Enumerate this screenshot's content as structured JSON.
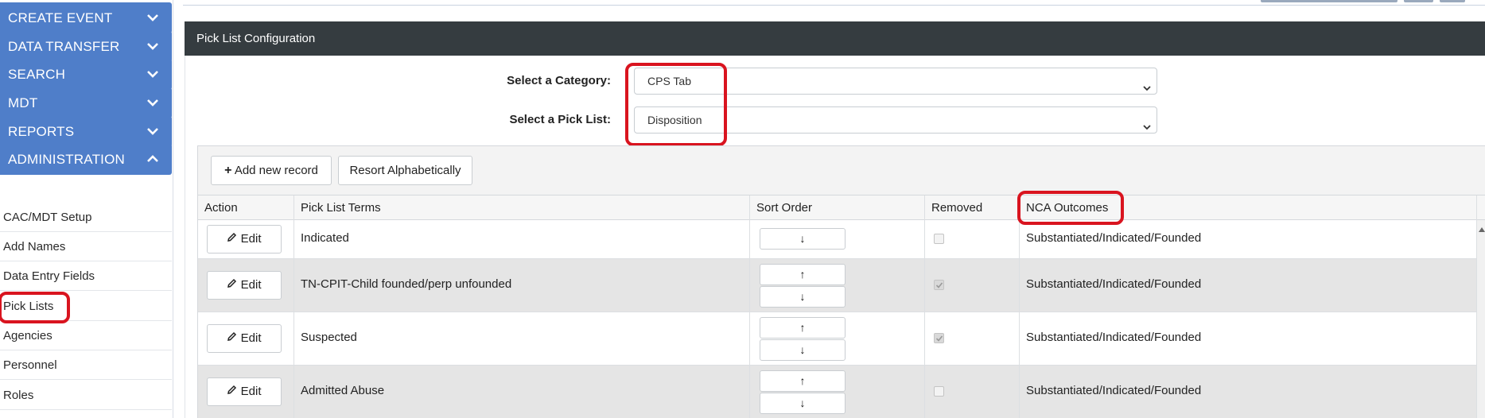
{
  "sidebar": {
    "sections": [
      {
        "label": "CREATE EVENT",
        "expanded": false
      },
      {
        "label": "DATA TRANSFER",
        "expanded": false
      },
      {
        "label": "SEARCH",
        "expanded": false
      },
      {
        "label": "MDT",
        "expanded": false
      },
      {
        "label": "REPORTS",
        "expanded": false
      },
      {
        "label": "ADMINISTRATION",
        "expanded": true
      }
    ],
    "admin_items": [
      {
        "label": "CAC/MDT Setup"
      },
      {
        "label": "Add Names"
      },
      {
        "label": "Data Entry Fields"
      },
      {
        "label": "Pick Lists"
      },
      {
        "label": "Agencies"
      },
      {
        "label": "Personnel"
      },
      {
        "label": "Roles"
      }
    ]
  },
  "panel": {
    "title": "Pick List Configuration",
    "category_label": "Select a Category:",
    "category_value": "CPS Tab",
    "picklist_label": "Select a Pick List:",
    "picklist_value": "Disposition"
  },
  "toolbar": {
    "add_label": "Add new record",
    "resort_label": "Resort Alphabetically"
  },
  "grid": {
    "columns": [
      "Action",
      "Pick List Terms",
      "Sort Order",
      "Removed",
      "NCA Outcomes"
    ],
    "edit_label": "Edit",
    "rows": [
      {
        "term": "Indicated",
        "removed": false,
        "outcome": "Substantiated/Indicated/Founded",
        "sort_buttons": [
          "↓"
        ]
      },
      {
        "term": "TN-CPIT-Child founded/perp unfounded",
        "removed": true,
        "outcome": "Substantiated/Indicated/Founded",
        "sort_buttons": [
          "↑",
          "↓"
        ]
      },
      {
        "term": "Suspected",
        "removed": true,
        "outcome": "Substantiated/Indicated/Founded",
        "sort_buttons": [
          "↑",
          "↓"
        ]
      },
      {
        "term": "Admitted Abuse",
        "removed": false,
        "outcome": "Substantiated/Indicated/Founded",
        "sort_buttons": [
          "↑",
          "↓"
        ]
      }
    ]
  },
  "colors": {
    "nav_blue": "#4f7ec9",
    "header_dark": "#353c40",
    "highlight_red": "#d9141f"
  }
}
